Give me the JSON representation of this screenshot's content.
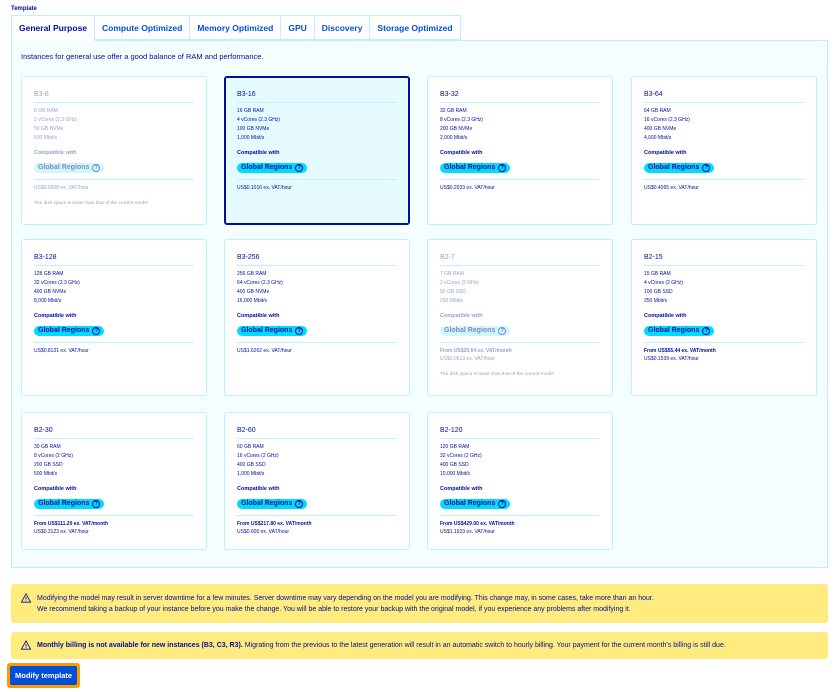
{
  "template_label": "Template",
  "tabs": [
    {
      "label": "General Purpose",
      "active": true
    },
    {
      "label": "Compute Optimized"
    },
    {
      "label": "Memory Optimized"
    },
    {
      "label": "GPU"
    },
    {
      "label": "Discovery"
    },
    {
      "label": "Storage Optimized"
    }
  ],
  "description": "Instances for general use offer a good balance of RAM and performance.",
  "compatible_label": "Compatible with",
  "region_badge": "Global Regions",
  "help_glyph": "?",
  "cards": [
    {
      "name": "B3-8",
      "specs": [
        "8 GB RAM",
        "2 vCores (2.3 GHz)",
        "50 GB NVMe",
        "500 Mbit/s"
      ],
      "price_month": "",
      "price_hour": "US$0.0508 ex. VAT/hour",
      "note": "The disk space is lower than that of the current model",
      "state": "disabled"
    },
    {
      "name": "B3-16",
      "specs": [
        "16 GB RAM",
        "4 vCores (2.3 GHz)",
        "100 GB NVMe",
        "1,000 Mbit/s"
      ],
      "price_month": "",
      "price_hour": "US$0.1016 ex. VAT/hour",
      "note": "",
      "state": "selected"
    },
    {
      "name": "B3-32",
      "specs": [
        "32 GB RAM",
        "8 vCores (2.3 GHz)",
        "200 GB NVMe",
        "2,000 Mbit/s"
      ],
      "price_month": "",
      "price_hour": "US$0.2033 ex. VAT/hour",
      "note": "",
      "state": "normal"
    },
    {
      "name": "B3-64",
      "specs": [
        "64 GB RAM",
        "16 vCores (2.3 GHz)",
        "400 GB NVMe",
        "4,000 Mbit/s"
      ],
      "price_month": "",
      "price_hour": "US$0.4065 ex. VAT/hour",
      "note": "",
      "state": "normal"
    },
    {
      "name": "B3-128",
      "specs": [
        "128 GB RAM",
        "32 vCores (2.3 GHz)",
        "400 GB NVMe",
        "8,000 Mbit/s"
      ],
      "price_month": "",
      "price_hour": "US$0.8131 ex. VAT/hour",
      "note": "",
      "state": "normal"
    },
    {
      "name": "B3-256",
      "specs": [
        "256 GB RAM",
        "64 vCores (2.3 GHz)",
        "400 GB NVMe",
        "16,000 Mbit/s"
      ],
      "price_month": "",
      "price_hour": "US$1.6262 ex. VAT/hour",
      "note": "",
      "state": "normal"
    },
    {
      "name": "B2-7",
      "specs": [
        "7 GB RAM",
        "2 vCores (2 GHz)",
        "50 GB SSD",
        "250 Mbit/s"
      ],
      "price_month": "From US$20.64 ex. VAT/month",
      "price_hour": "US$0.0613 ex. VAT/hour",
      "note": "The disk space is lower than that of the current model",
      "state": "disabled"
    },
    {
      "name": "B2-15",
      "specs": [
        "15 GB RAM",
        "4 vCores (2 GHz)",
        "100 GB SSD",
        "250 Mbit/s"
      ],
      "price_month": "From US$55.44 ex. VAT/month",
      "price_hour": "US$0.1539 ex. VAT/hour",
      "note": "",
      "state": "normal"
    },
    {
      "name": "B2-30",
      "specs": [
        "30 GB RAM",
        "8 vCores (2 GHz)",
        "200 GB SSD",
        "500 Mbit/s"
      ],
      "price_month": "From US$111.20 ex. VAT/month",
      "price_hour": "US$0.3123 ex. VAT/hour",
      "note": "",
      "state": "normal"
    },
    {
      "name": "B2-60",
      "specs": [
        "60 GB RAM",
        "16 vCores (2 GHz)",
        "400 GB SSD",
        "1,000 Mbit/s"
      ],
      "price_month": "From US$217.80 ex. VAT/month",
      "price_hour": "US$0.606 ex. VAT/hour",
      "note": "",
      "state": "normal"
    },
    {
      "name": "B2-120",
      "specs": [
        "120 GB RAM",
        "32 vCores (2 GHz)",
        "400 GB SSD",
        "10,000 Mbit/s"
      ],
      "price_month": "From US$429.00 ex. VAT/month",
      "price_hour": "US$1.1923 ex. VAT/hour",
      "note": "",
      "state": "normal"
    }
  ],
  "alert1": {
    "line1": "Modifying the model may result in server downtime for a few minutes. Server downtime may vary depending on the model you are modifying. This change may, in some cases, take more than an hour.",
    "line2": "We recommend taking a backup of your instance before you make the change. You will be able to restore your backup with the original model, if you experience any problems after modifying it."
  },
  "alert2": {
    "bold": "Monthly billing is not available for new instances (B3, C3, R3).",
    "text": " Migrating from the previous to the latest generation will result in an automatic switch to hourly billing. Your payment for the current month's billing is still due."
  },
  "button_label": "Modify template",
  "colors": {
    "accent": "#000e9c",
    "badge": "#00dbff",
    "warning": "#ffeb7e",
    "button": "#0050d7",
    "focus": "#ff9803"
  }
}
